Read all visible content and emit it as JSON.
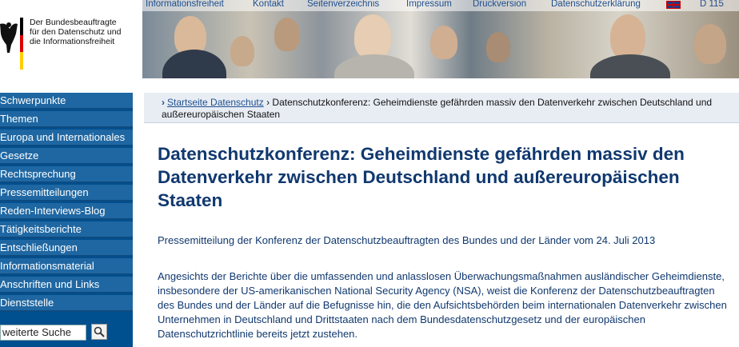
{
  "header": {
    "logo_lines": [
      "Der Bundesbeauftragte",
      "für den Datenschutz und",
      "die Informationsfreiheit"
    ],
    "topnav": [
      "Informationsfreiheit",
      "Kontakt",
      "Seitenverzeichnis",
      "Impressum",
      "Druckversion",
      "Datenschutzerklärung",
      "D 115"
    ]
  },
  "sidebar": {
    "items": [
      {
        "label": "Schwerpunkte"
      },
      {
        "label": "Themen"
      },
      {
        "label": "Europa und Internationales"
      },
      {
        "label": "Gesetze"
      },
      {
        "label": "Rechtsprechung"
      },
      {
        "label": "Pressemitteilungen"
      },
      {
        "label": "Reden-Interviews-Blog"
      },
      {
        "label": "Tätigkeitsberichte"
      },
      {
        "label": "Entschließungen"
      },
      {
        "label": "Informationsmaterial"
      },
      {
        "label": "Anschriften und Links"
      },
      {
        "label": "Dienststelle"
      }
    ],
    "search_value": "weiterte Suche"
  },
  "breadcrumb": {
    "link": "Startseite Datenschutz",
    "separator": "›",
    "current": "Datenschutzkonferenz: Geheimdienste gefährden massiv den Datenverkehr zwischen Deutschland und außereuropäischen Staaten"
  },
  "main": {
    "title": "Datenschutzkonferenz: Geheimdienste gefährden massiv den Datenverkehr zwischen Deutschland und außereuropäischen Staaten",
    "subtitle": "Pressemitteilung der Konferenz der Datenschutzbeauftragten des Bundes und der Länder vom 24. Juli 2013",
    "body": "Angesichts der Berichte über die umfassenden und anlasslosen Überwachungsmaßnahmen ausländischer Geheimdienste, insbesondere der US-amerikanischen National Security Agency (NSA), weist die Konferenz der Datenschutzbeauftragten des Bundes und der Länder auf die Befugnisse hin, die den Aufsichtsbehörden beim internationalen Datenverkehr zwischen Unternehmen in Deutschland und Drittstaaten nach dem Bundesdatenschutzgesetz und der europäischen Datenschutzrichtlinie bereits jetzt zustehen."
  },
  "icons": {
    "eagle": "federal-eagle-icon",
    "flag": "german-flag-icon",
    "uk_flag": "uk-flag-icon",
    "search": "magnifier-icon"
  },
  "colors": {
    "sidebar_bg": "#1f67a2",
    "title": "#10386f",
    "link": "#1e4f8f",
    "breadcrumb_bg": "#e8edf4"
  }
}
